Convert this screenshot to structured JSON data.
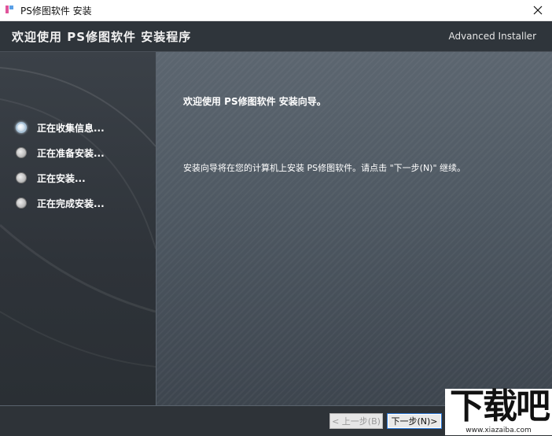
{
  "window": {
    "title": "PS修图软件 安装"
  },
  "header": {
    "title": "欢迎使用 PS修图软件 安装程序",
    "brand": "Advanced Installer"
  },
  "steps": [
    {
      "label": "正在收集信息...",
      "state": "active"
    },
    {
      "label": "正在准备安装...",
      "state": "pending"
    },
    {
      "label": "正在安装...",
      "state": "pending"
    },
    {
      "label": "正在完成安装...",
      "state": "pending"
    }
  ],
  "main": {
    "welcome": "欢迎使用 PS修图软件 安装向导。",
    "description": "安装向导将在您的计算机上安装 PS修图软件。请点击 \"下一步(N)\" 继续。"
  },
  "footer": {
    "prev_label": "< 上一步(B)",
    "next_label": "下一步(N)>"
  },
  "watermark": {
    "logo_text": "下载吧",
    "url": "www.xiazaiba.com"
  },
  "colors": {
    "header_bg": "#2f353b",
    "accent_focus": "#2f7ad6"
  },
  "icons": {
    "app": "app-icon",
    "close": "close-icon",
    "step_indicator": "radio-indicator-icon"
  }
}
